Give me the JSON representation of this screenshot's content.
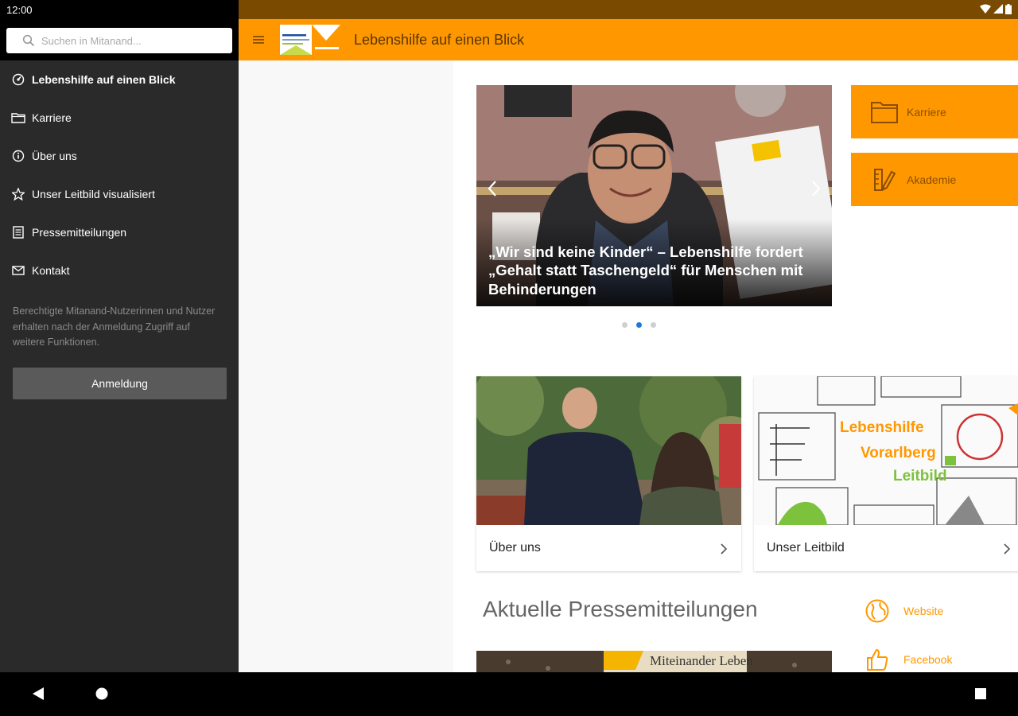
{
  "status": {
    "time": "12:00"
  },
  "search": {
    "placeholder": "Suchen in Mitanand..."
  },
  "drawer": {
    "items": [
      {
        "label": "Lebenshilfe auf einen Blick",
        "icon": "dashboard-icon"
      },
      {
        "label": "Karriere",
        "icon": "folder-icon"
      },
      {
        "label": "Über uns",
        "icon": "info-icon"
      },
      {
        "label": "Unser Leitbild visualisiert",
        "icon": "star-icon"
      },
      {
        "label": "Pressemitteilungen",
        "icon": "document-icon"
      },
      {
        "label": "Kontakt",
        "icon": "mail-icon"
      }
    ],
    "note": "Berechtigte Mitanand-Nutzerinnen und Nutzer erhalten nach der Anmeldung Zugriff auf weitere Funktionen.",
    "login_label": "Anmeldung"
  },
  "appbar": {
    "title": "Lebenshilfe auf einen Blick"
  },
  "slider": {
    "caption": "„Wir sind keine Kinder“ – Lebenshilfe fordert „Gehalt statt Taschengeld“ für Menschen mit Behinderungen",
    "dots_count": 3,
    "active_dot": 2
  },
  "tiles": [
    {
      "label": "Karriere",
      "icon": "folder-icon"
    },
    {
      "label": "Akademie",
      "icon": "pencil-ruler-icon"
    }
  ],
  "cards": [
    {
      "label": "Über uns"
    },
    {
      "label": "Unser Leitbild"
    }
  ],
  "leitbild_art": {
    "line1": "Lebenshilfe",
    "line2": "Vorarlberg",
    "line3": "Leitbild"
  },
  "press": {
    "title": "Aktuelle Pressemitteilungen",
    "image_text": "Miteinander Leben"
  },
  "links": [
    {
      "label": "Website",
      "icon": "globe-icon"
    },
    {
      "label": "Facebook",
      "icon": "thumbs-up-icon"
    }
  ],
  "colors": {
    "accent": "#ff9800",
    "drawer_bg": "#2a2a2a",
    "dot_active": "#1e78d6"
  }
}
